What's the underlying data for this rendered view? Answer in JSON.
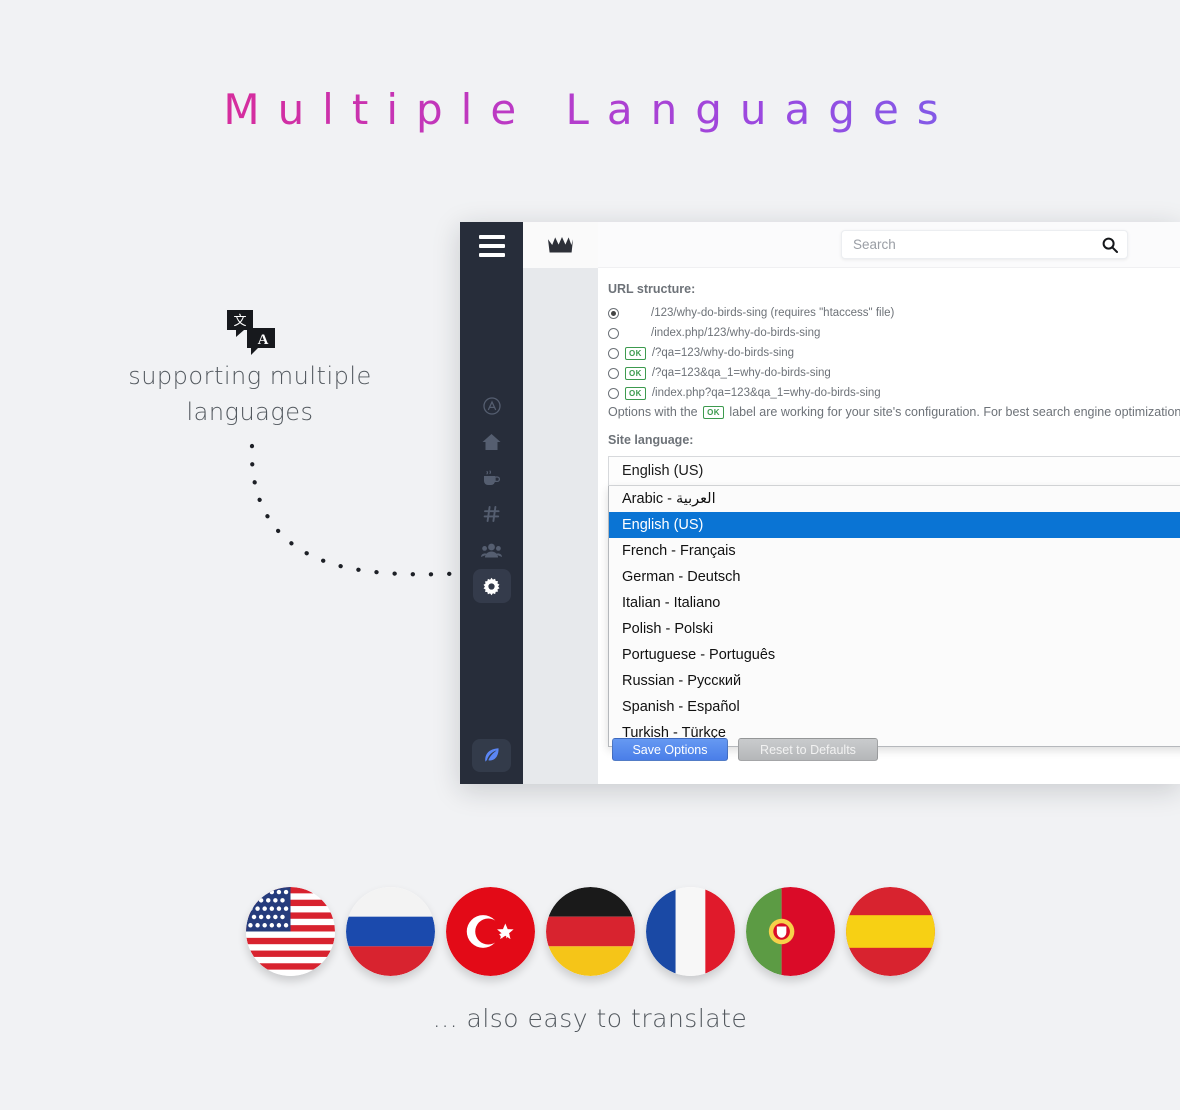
{
  "hero": {
    "title": "Multiple Languages",
    "annotation_left_line1": "supporting multiple",
    "annotation_left_line2": "languages",
    "annotation_bottom": "... also easy to translate",
    "gradient_from": "#e8318f",
    "gradient_to": "#6f7de4"
  },
  "icons": {
    "translate": "translate-icon",
    "hamburger": "hamburger-icon",
    "crown": "crown-icon",
    "search": "search-icon"
  },
  "sidebar": {
    "rail_items": [
      {
        "name": "apps-icon",
        "label": "Apps",
        "active": false
      },
      {
        "name": "home-icon",
        "label": "Home",
        "active": false
      },
      {
        "name": "coffee-icon",
        "label": "Activity",
        "active": false
      },
      {
        "name": "hash-icon",
        "label": "Categories",
        "active": false
      },
      {
        "name": "users-icon",
        "label": "Users",
        "active": false
      },
      {
        "name": "gear-icon",
        "label": "Settings",
        "active": true
      }
    ],
    "compose_item": {
      "name": "feather-icon",
      "label": "Ask a question"
    }
  },
  "header": {
    "logo": "crown-icon",
    "search_placeholder": "Search",
    "search_value": ""
  },
  "settings": {
    "url_structure_label": "URL structure:",
    "url_options": [
      {
        "text": "/123/why-do-birds-sing (requires \"htaccess\" file)",
        "ok": false,
        "checked": true
      },
      {
        "text": "/index.php/123/why-do-birds-sing",
        "ok": false,
        "checked": false
      },
      {
        "text": "/?qa=123/why-do-birds-sing",
        "ok": true,
        "checked": false
      },
      {
        "text": "/?qa=123&qa_1=why-do-birds-sing",
        "ok": true,
        "checked": false
      },
      {
        "text": "/index.php?qa=123&qa_1=why-do-birds-sing",
        "ok": true,
        "checked": false
      }
    ],
    "ok_label": "OK",
    "seo_note_before": "Options with the",
    "seo_note_after": "label are working for your site's configuration. For best search engine optimization (SEO), use t",
    "site_language_label": "Site language:",
    "selected_language": "English (US)",
    "language_options": [
      {
        "label": "Arabic - العربية",
        "selected": false
      },
      {
        "label": "English (US)",
        "selected": true
      },
      {
        "label": "French - Français",
        "selected": false
      },
      {
        "label": "German - Deutsch",
        "selected": false
      },
      {
        "label": "Italian - Italiano",
        "selected": false
      },
      {
        "label": "Polish - Polski",
        "selected": false
      },
      {
        "label": "Portuguese - Português",
        "selected": false
      },
      {
        "label": "Russian - Русский",
        "selected": false
      },
      {
        "label": "Spanish - Español",
        "selected": false
      },
      {
        "label": "Turkish - Türkçe",
        "selected": false
      }
    ],
    "save_button": "Save Options",
    "reset_button": "Reset to Defaults",
    "save_color": "#5b8cf0",
    "highlight_color": "#0a74d4"
  },
  "flags": [
    {
      "name": "flag-united-states",
      "label": "United States"
    },
    {
      "name": "flag-russia",
      "label": "Russia"
    },
    {
      "name": "flag-turkey",
      "label": "Turkey"
    },
    {
      "name": "flag-germany",
      "label": "Germany"
    },
    {
      "name": "flag-france",
      "label": "France"
    },
    {
      "name": "flag-portugal",
      "label": "Portugal"
    },
    {
      "name": "flag-spain",
      "label": "Spain"
    }
  ]
}
